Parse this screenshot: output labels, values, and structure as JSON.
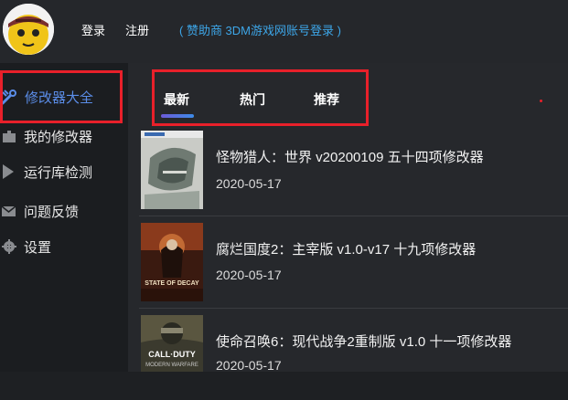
{
  "header": {
    "login": "登录",
    "register": "注册",
    "sponsor": "( 赞助商 3DM游戏网账号登录 )"
  },
  "sidebar": {
    "items": [
      {
        "label": "修改器大全",
        "icon": "wrench-icon",
        "active": true
      },
      {
        "label": "我的修改器",
        "icon": "puzzle-icon",
        "active": false
      },
      {
        "label": "运行库检测",
        "icon": "play-icon",
        "active": false
      },
      {
        "label": "问题反馈",
        "icon": "mail-icon",
        "active": false
      },
      {
        "label": "设置",
        "icon": "gear-icon",
        "active": false
      }
    ]
  },
  "tabs": [
    {
      "label": "最新",
      "selected": true
    },
    {
      "label": "热门",
      "selected": false
    },
    {
      "label": "推荐",
      "selected": false
    }
  ],
  "trainers": [
    {
      "title": "怪物猎人：世界 v20200109 五十四项修改器",
      "date": "2020-05-17",
      "cover": "monster-hunter-cover"
    },
    {
      "title": "腐烂国度2：主宰版 v1.0-v17 十九项修改器",
      "date": "2020-05-17",
      "cover": "state-of-decay-cover"
    },
    {
      "title": "使命召唤6：现代战争2重制版 v1.0 十一项修改器",
      "date": "2020-05-17",
      "cover": "call-of-duty-cover"
    }
  ],
  "covers": {
    "cod_text_1": "CALL·DUTY",
    "cod_text_2": "MODERN WARFARE",
    "sod_text": "STATE OF DECAY"
  },
  "colors": {
    "accent_blue": "#3da6e8",
    "active_nav": "#5b8de8",
    "highlight_red": "#e8202a",
    "background": "#1e2023"
  }
}
